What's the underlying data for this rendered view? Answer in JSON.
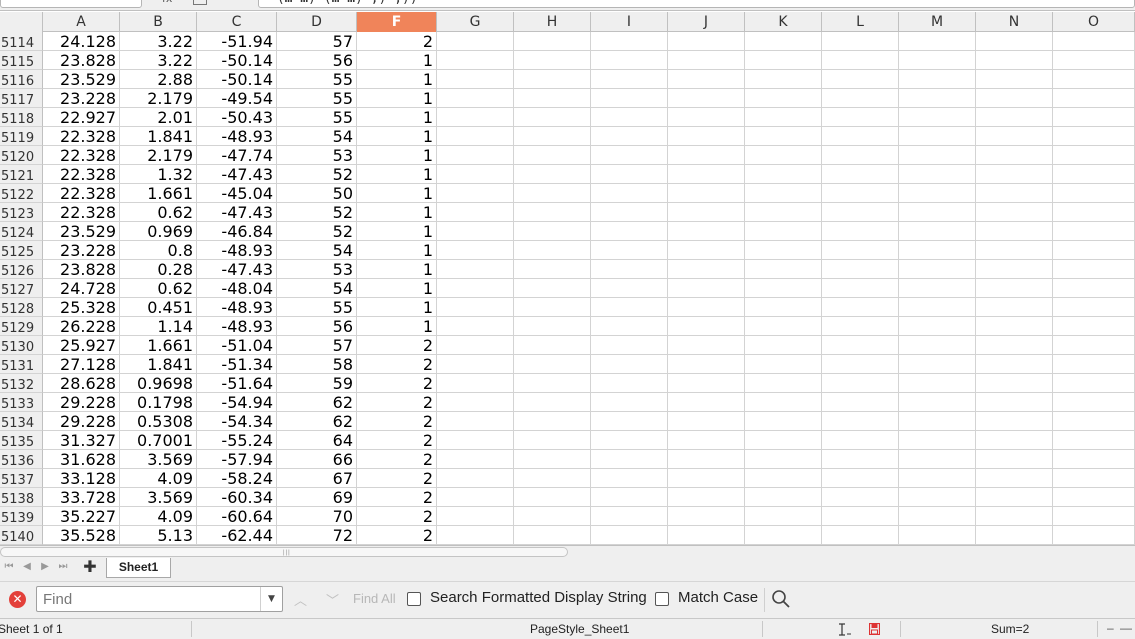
{
  "formula_bar": {
    "fx_label": "fx",
    "formula_text": "=(…   …) (…   …) ,) ,))"
  },
  "grid": {
    "columns": [
      "A",
      "B",
      "C",
      "D",
      "F",
      "G",
      "H",
      "I",
      "J",
      "K",
      "L",
      "M",
      "N",
      "O"
    ],
    "selected_column": "F",
    "rows": [
      {
        "n": "5114",
        "v": [
          "24.128",
          "3.22",
          "-51.94",
          "57",
          "2"
        ]
      },
      {
        "n": "5115",
        "v": [
          "23.828",
          "3.22",
          "-50.14",
          "56",
          "1"
        ]
      },
      {
        "n": "5116",
        "v": [
          "23.529",
          "2.88",
          "-50.14",
          "55",
          "1"
        ]
      },
      {
        "n": "5117",
        "v": [
          "23.228",
          "2.179",
          "-49.54",
          "55",
          "1"
        ]
      },
      {
        "n": "5118",
        "v": [
          "22.927",
          "2.01",
          "-50.43",
          "55",
          "1"
        ]
      },
      {
        "n": "5119",
        "v": [
          "22.328",
          "1.841",
          "-48.93",
          "54",
          "1"
        ]
      },
      {
        "n": "5120",
        "v": [
          "22.328",
          "2.179",
          "-47.74",
          "53",
          "1"
        ]
      },
      {
        "n": "5121",
        "v": [
          "22.328",
          "1.32",
          "-47.43",
          "52",
          "1"
        ]
      },
      {
        "n": "5122",
        "v": [
          "22.328",
          "1.661",
          "-45.04",
          "50",
          "1"
        ]
      },
      {
        "n": "5123",
        "v": [
          "22.328",
          "0.62",
          "-47.43",
          "52",
          "1"
        ]
      },
      {
        "n": "5124",
        "v": [
          "23.529",
          "0.969",
          "-46.84",
          "52",
          "1"
        ]
      },
      {
        "n": "5125",
        "v": [
          "23.228",
          "0.8",
          "-48.93",
          "54",
          "1"
        ]
      },
      {
        "n": "5126",
        "v": [
          "23.828",
          "0.28",
          "-47.43",
          "53",
          "1"
        ]
      },
      {
        "n": "5127",
        "v": [
          "24.728",
          "0.62",
          "-48.04",
          "54",
          "1"
        ]
      },
      {
        "n": "5128",
        "v": [
          "25.328",
          "0.451",
          "-48.93",
          "55",
          "1"
        ]
      },
      {
        "n": "5129",
        "v": [
          "26.228",
          "1.14",
          "-48.93",
          "56",
          "1"
        ]
      },
      {
        "n": "5130",
        "v": [
          "25.927",
          "1.661",
          "-51.04",
          "57",
          "2"
        ]
      },
      {
        "n": "5131",
        "v": [
          "27.128",
          "1.841",
          "-51.34",
          "58",
          "2"
        ]
      },
      {
        "n": "5132",
        "v": [
          "28.628",
          "0.9698",
          "-51.64",
          "59",
          "2"
        ]
      },
      {
        "n": "5133",
        "v": [
          "29.228",
          "0.1798",
          "-54.94",
          "62",
          "2"
        ]
      },
      {
        "n": "5134",
        "v": [
          "29.228",
          "0.5308",
          "-54.34",
          "62",
          "2"
        ]
      },
      {
        "n": "5135",
        "v": [
          "31.327",
          "0.7001",
          "-55.24",
          "64",
          "2"
        ]
      },
      {
        "n": "5136",
        "v": [
          "31.628",
          "3.569",
          "-57.94",
          "66",
          "2"
        ]
      },
      {
        "n": "5137",
        "v": [
          "33.128",
          "4.09",
          "-58.24",
          "67",
          "2"
        ]
      },
      {
        "n": "5138",
        "v": [
          "33.728",
          "3.569",
          "-60.34",
          "69",
          "2"
        ]
      },
      {
        "n": "5139",
        "v": [
          "35.227",
          "4.09",
          "-60.64",
          "70",
          "2"
        ]
      },
      {
        "n": "5140",
        "v": [
          "35.528",
          "5.13",
          "-62.44",
          "72",
          "2"
        ]
      }
    ]
  },
  "sheet_tabs": {
    "active": "Sheet1",
    "add_icon": "plus-icon"
  },
  "find_toolbar": {
    "placeholder": "Find",
    "value": "",
    "find_all_label": "Find All",
    "search_formatted_label": "Search Formatted Display String",
    "search_formatted_checked": false,
    "match_case_label": "Match Case",
    "match_case_checked": false,
    "close_icon": "close-icon",
    "search_icon": "magnifier-icon"
  },
  "status_bar": {
    "sheet_info": "Sheet 1 of 1",
    "page_style": "PageStyle_Sheet1",
    "selection_mode_icon": "text-cursor-icon",
    "save_indicator_icon": "document-modified-icon",
    "sum": "Sum=2",
    "zoom_minus": "–",
    "zoom_slider": "—"
  },
  "colors": {
    "selected_header": "#f0845a",
    "header_bg": "#efefef",
    "gridline": "#d3d3d3",
    "close_red": "#e3403a"
  }
}
